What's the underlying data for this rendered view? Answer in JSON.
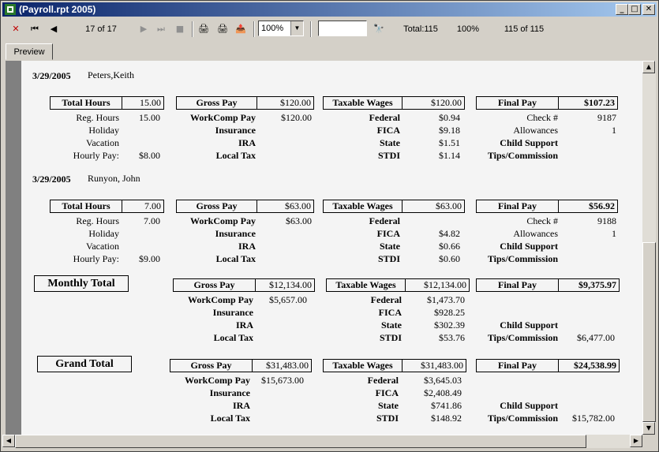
{
  "window": {
    "title": "(Payroll.rpt 2005)"
  },
  "toolbar": {
    "close_icon": "✕",
    "first_icon": "⏮",
    "prev_icon": "◀",
    "page_status": "17 of 17",
    "next_icon": "▶",
    "last_icon": "⏭",
    "stop_icon": "■",
    "print_icon": "🖨",
    "print_setup_icon": "🖨",
    "export_icon": "📤",
    "zoom_value": "100%",
    "search_placeholder": "",
    "find_icon": "🔭",
    "total_label": "Total:115",
    "percent_label": "100%",
    "record_label": "115 of 115"
  },
  "tabs": {
    "preview": "Preview"
  },
  "report": {
    "employees": [
      {
        "date": "3/29/2005",
        "name": "Peters,Keith",
        "total_hours_label": "Total Hours",
        "total_hours": "15.00",
        "reg_hours_label": "Reg. Hours",
        "reg_hours": "15.00",
        "holiday_label": "Holiday",
        "vacation_label": "Vacation",
        "hourly_pay_label": "Hourly Pay:",
        "hourly_pay": "$8.00",
        "gross_pay_label": "Gross Pay",
        "gross_pay": "$120.00",
        "workcomp_label": "WorkComp Pay",
        "workcomp": "$120.00",
        "insurance_label": "Insurance",
        "ira_label": "IRA",
        "local_tax_label": "Local Tax",
        "taxable_label": "Taxable Wages",
        "taxable": "$120.00",
        "federal_label": "Federal",
        "federal": "$0.94",
        "fica_label": "FICA",
        "fica": "$9.18",
        "state_label": "State",
        "state": "$1.51",
        "stdi_label": "STDI",
        "stdi": "$1.14",
        "final_pay_label": "Final Pay",
        "final_pay": "$107.23",
        "check_label": "Check #",
        "check": "9187",
        "allowances_label": "Allowances",
        "allowances": "1",
        "child_support_label": "Child Support",
        "tips_label": "Tips/Commission"
      },
      {
        "date": "3/29/2005",
        "name": "Runyon, John",
        "total_hours_label": "Total Hours",
        "total_hours": "7.00",
        "reg_hours_label": "Reg. Hours",
        "reg_hours": "7.00",
        "holiday_label": "Holiday",
        "vacation_label": "Vacation",
        "hourly_pay_label": "Hourly Pay:",
        "hourly_pay": "$9.00",
        "gross_pay_label": "Gross Pay",
        "gross_pay": "$63.00",
        "workcomp_label": "WorkComp Pay",
        "workcomp": "$63.00",
        "insurance_label": "Insurance",
        "ira_label": "IRA",
        "local_tax_label": "Local Tax",
        "taxable_label": "Taxable Wages",
        "taxable": "$63.00",
        "federal_label": "Federal",
        "federal": "",
        "fica_label": "FICA",
        "fica": "$4.82",
        "state_label": "State",
        "state": "$0.66",
        "stdi_label": "STDI",
        "stdi": "$0.60",
        "final_pay_label": "Final Pay",
        "final_pay": "$56.92",
        "check_label": "Check #",
        "check": "9188",
        "allowances_label": "Allowances",
        "allowances": "1",
        "child_support_label": "Child Support",
        "tips_label": "Tips/Commission"
      }
    ],
    "monthly_total": {
      "title": "Monthly Total",
      "gross_pay_label": "Gross Pay",
      "gross_pay": "$12,134.00",
      "workcomp_label": "WorkComp Pay",
      "workcomp": "$5,657.00",
      "insurance_label": "Insurance",
      "ira_label": "IRA",
      "local_tax_label": "Local Tax",
      "taxable_label": "Taxable Wages",
      "taxable": "$12,134.00",
      "federal_label": "Federal",
      "federal": "$1,473.70",
      "fica_label": "FICA",
      "fica": "$928.25",
      "state_label": "State",
      "state": "$302.39",
      "stdi_label": "STDI",
      "stdi": "$53.76",
      "final_pay_label": "Final Pay",
      "final_pay": "$9,375.97",
      "child_support_label": "Child Support",
      "tips_label": "Tips/Commission",
      "tips": "$6,477.00"
    },
    "grand_total": {
      "title": "Grand Total",
      "gross_pay_label": "Gross Pay",
      "gross_pay": "$31,483.00",
      "workcomp_label": "WorkComp Pay",
      "workcomp": "$15,673.00",
      "insurance_label": "Insurance",
      "ira_label": "IRA",
      "local_tax_label": "Local Tax",
      "taxable_label": "Taxable Wages",
      "taxable": "$31,483.00",
      "federal_label": "Federal",
      "federal": "$3,645.03",
      "fica_label": "FICA",
      "fica": "$2,408.49",
      "state_label": "State",
      "state": "$741.86",
      "stdi_label": "STDI",
      "stdi": "$148.92",
      "final_pay_label": "Final Pay",
      "final_pay": "$24,538.99",
      "child_support_label": "Child Support",
      "tips_label": "Tips/Commission",
      "tips": "$15,782.00"
    }
  }
}
